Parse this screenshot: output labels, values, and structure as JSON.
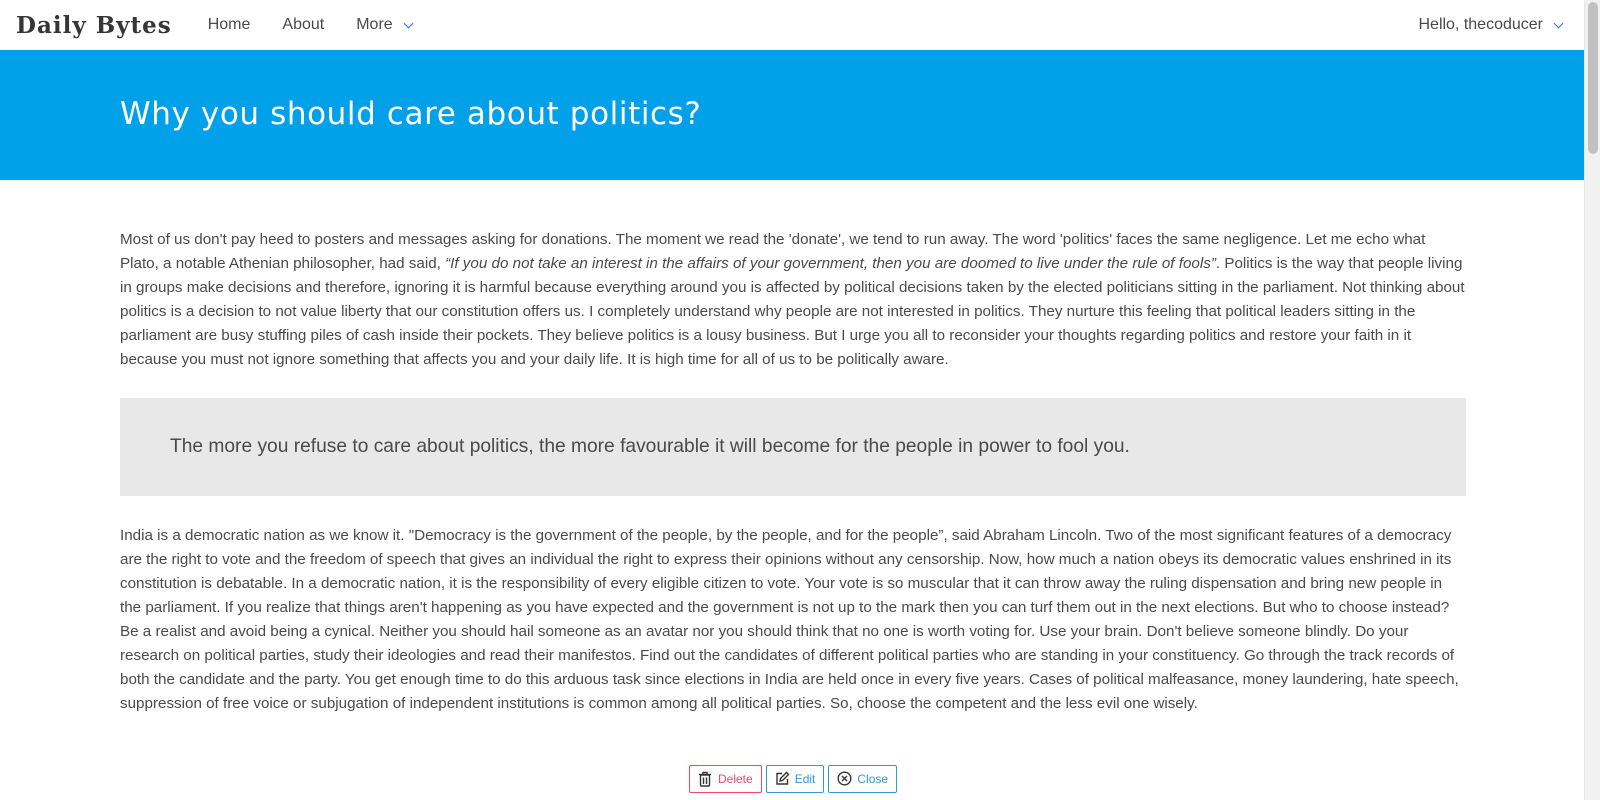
{
  "nav": {
    "brand": "Daily Bytes",
    "links": [
      "Home",
      "About",
      "More"
    ],
    "user_greeting": "Hello, thecoducer"
  },
  "hero": {
    "title": "Why you should care about politics?"
  },
  "article": {
    "paragraph1_before_quote": "Most of us don't pay heed to posters and messages asking for donations. The moment we read the 'donate', we tend to run away. The word 'politics' faces the same negligence. Let me echo what Plato, a notable Athenian philosopher, had said, ",
    "paragraph1_quote": "“If you do not take an interest in the affairs of your government, then you are doomed to live under the rule of fools”",
    "paragraph1_after_quote": ". Politics is the way that people living in groups make decisions and therefore, ignoring it is harmful because everything around you is affected by political decisions taken by the elected politicians sitting in the parliament. Not thinking about politics is a decision to not value liberty that our constitution offers us. I completely understand why people are not interested in politics. They nurture this feeling that political leaders sitting in the parliament are busy stuffing piles of cash inside their pockets. They believe politics is a lousy business. But I urge you all to reconsider your thoughts regarding politics and restore your faith in it because you must not ignore something that affects you and your daily life. It is high time for all of us to be politically aware.",
    "blockquote": "The more you refuse to care about politics, the more favourable it will become for the people in power to fool you.",
    "paragraph2": "India is a democratic nation as we know it. \"Democracy is the government of the people, by the people, and for the people”, said Abraham Lincoln. Two of the most significant features of a democracy are the right to vote and the freedom of speech that gives an individual the right to express their opinions without any censorship. Now, how much a nation obeys its democratic values enshrined in its constitution is debatable. In a democratic nation, it is the responsibility of every eligible citizen to vote. Your vote is so muscular that it can throw away the ruling dispensation and bring new people in the parliament. If you realize that things aren't happening as you have expected and the government is not up to the mark then you can turf them out in the next elections. But who to choose instead? Be a realist and avoid being a cynical. Neither you should hail someone as an avatar nor you should think that no one is worth voting for. Use your brain. Don't believe someone blindly. Do your research on political parties, study their ideologies and read their manifestos. Find out the candidates of different political parties who are standing in your constituency. Go through the track records of both the candidate and the party. You get enough time to do this arduous task since elections in India are held once in every five years. Cases of political malfeasance, money laundering, hate speech, suppression of free voice or subjugation of independent institutions is common among all political parties. So, choose the competent and the less evil one wisely."
  },
  "actions": {
    "delete_label": "Delete",
    "edit_label": "Edit",
    "close_label": "Close"
  },
  "colors": {
    "hero_bg": "#00a1e9",
    "delete": "#f14668",
    "info": "#3298dc"
  },
  "icons": {
    "more_dropdown": "chevron-down-icon",
    "user_dropdown": "chevron-down-icon",
    "delete": "trash-icon",
    "edit": "edit-icon",
    "close": "close-circle-icon"
  }
}
